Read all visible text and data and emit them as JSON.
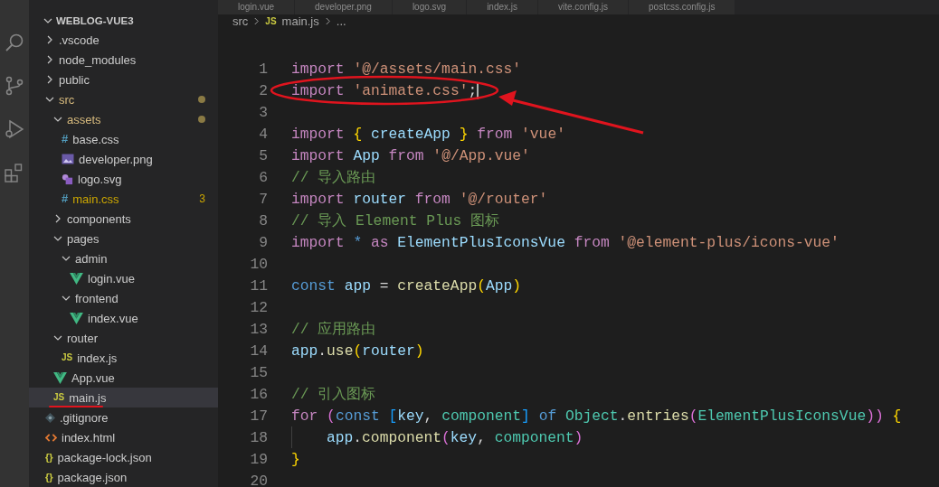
{
  "tabs": [
    {
      "label": "login.vue",
      "selected": false
    },
    {
      "label": "developer.png",
      "selected": false
    },
    {
      "label": "logo.svg",
      "selected": false
    },
    {
      "label": "index.js",
      "selected": false
    },
    {
      "label": "vite.config.js",
      "selected": false
    },
    {
      "label": "postcss.config.js",
      "selected": false
    }
  ],
  "explorer": {
    "title": "WEBLOG-VUE3",
    "expanded": true,
    "items": [
      {
        "name": ".vscode",
        "kind": "folder",
        "expanded": false,
        "selected": false,
        "modified": false
      },
      {
        "name": "node_modules",
        "kind": "folder",
        "expanded": false,
        "selected": false,
        "modified": false
      },
      {
        "name": "public",
        "kind": "folder",
        "expanded": false,
        "selected": false,
        "modified": false
      },
      {
        "name": "src",
        "kind": "folder",
        "expanded": true,
        "selected": false,
        "modified": true,
        "children": [
          {
            "name": "assets",
            "kind": "folder",
            "expanded": true,
            "selected": false,
            "modified": true,
            "children": [
              {
                "name": "base.css",
                "kind": "css",
                "icon": "#",
                "selected": false,
                "modified": false
              },
              {
                "name": "developer.png",
                "kind": "image",
                "selected": false,
                "modified": false
              },
              {
                "name": "logo.svg",
                "kind": "svg",
                "selected": false,
                "modified": false
              },
              {
                "name": "main.css",
                "kind": "css",
                "icon": "#",
                "selected": false,
                "modified": false,
                "badge": "3"
              }
            ]
          },
          {
            "name": "components",
            "kind": "folder",
            "expanded": false,
            "selected": false,
            "modified": false
          },
          {
            "name": "pages",
            "kind": "folder",
            "expanded": true,
            "selected": false,
            "modified": false,
            "children": [
              {
                "name": "admin",
                "kind": "folder",
                "expanded": true,
                "selected": false,
                "modified": false,
                "children": [
                  {
                    "name": "login.vue",
                    "kind": "vue",
                    "selected": false,
                    "modified": false
                  }
                ]
              },
              {
                "name": "frontend",
                "kind": "folder",
                "expanded": true,
                "selected": false,
                "modified": false,
                "children": [
                  {
                    "name": "index.vue",
                    "kind": "vue",
                    "selected": false,
                    "modified": false
                  }
                ]
              }
            ]
          },
          {
            "name": "router",
            "kind": "folder",
            "expanded": true,
            "selected": false,
            "modified": false,
            "children": [
              {
                "name": "index.js",
                "kind": "js",
                "icon": "JS",
                "selected": false,
                "modified": false
              }
            ]
          },
          {
            "name": "App.vue",
            "kind": "vue",
            "selected": false,
            "modified": false
          },
          {
            "name": "main.js",
            "kind": "js",
            "icon": "JS",
            "selected": true,
            "modified": false
          }
        ]
      },
      {
        "name": ".gitignore",
        "kind": "git",
        "selected": false,
        "modified": false
      },
      {
        "name": "index.html",
        "kind": "html",
        "selected": false,
        "modified": false
      },
      {
        "name": "package-lock.json",
        "kind": "json",
        "icon": "{}",
        "selected": false,
        "modified": false
      },
      {
        "name": "package.json",
        "kind": "json",
        "icon": "{}",
        "selected": false,
        "modified": false
      }
    ]
  },
  "breadcrumb": {
    "parts": [
      {
        "text": "src",
        "kind": "folder"
      },
      {
        "text": "main.js",
        "kind": "js",
        "icon": "JS"
      },
      {
        "text": "...",
        "kind": "more"
      }
    ]
  },
  "editor": {
    "lines": [
      {
        "number": "1",
        "cursor": false,
        "tokens": [
          {
            "text": "import ",
            "kind": "keyword"
          },
          {
            "text": "'@/assets/main.css'",
            "kind": "string"
          }
        ]
      },
      {
        "number": "2",
        "cursor": true,
        "tokens": [
          {
            "text": "import ",
            "kind": "keyword"
          },
          {
            "text": "'animate.css'",
            "kind": "string"
          },
          {
            "text": ";",
            "kind": "plain"
          }
        ]
      },
      {
        "number": "3",
        "cursor": false
      },
      {
        "number": "4",
        "cursor": false,
        "tokens": [
          {
            "text": "import ",
            "kind": "keyword"
          },
          {
            "text": "{",
            "kind": "brace"
          },
          {
            "text": " createApp ",
            "kind": "variable"
          },
          {
            "text": "}",
            "kind": "brace"
          },
          {
            "text": " from ",
            "kind": "keyword"
          },
          {
            "text": "'vue'",
            "kind": "string"
          }
        ]
      },
      {
        "number": "5",
        "cursor": false,
        "tokens": [
          {
            "text": "import ",
            "kind": "keyword"
          },
          {
            "text": "App ",
            "kind": "variable"
          },
          {
            "text": "from ",
            "kind": "keyword"
          },
          {
            "text": "'@/App.vue'",
            "kind": "string"
          }
        ]
      },
      {
        "number": "6",
        "cursor": false,
        "tokens": [
          {
            "text": "// 导入路由",
            "kind": "comment"
          }
        ]
      },
      {
        "number": "7",
        "cursor": false,
        "tokens": [
          {
            "text": "import ",
            "kind": "keyword"
          },
          {
            "text": "router ",
            "kind": "variable"
          },
          {
            "text": "from ",
            "kind": "keyword"
          },
          {
            "text": "'@/router'",
            "kind": "string"
          }
        ]
      },
      {
        "number": "8",
        "cursor": false,
        "tokens": [
          {
            "text": "// 导入 Element Plus 图标",
            "kind": "comment"
          }
        ]
      },
      {
        "number": "9",
        "cursor": false,
        "tokens": [
          {
            "text": "import ",
            "kind": "keyword"
          },
          {
            "text": "* ",
            "kind": "storage"
          },
          {
            "text": "as ",
            "kind": "keyword"
          },
          {
            "text": "ElementPlusIconsVue ",
            "kind": "variable"
          },
          {
            "text": "from ",
            "kind": "keyword"
          },
          {
            "text": "'@element-plus/icons-vue'",
            "kind": "string"
          }
        ]
      },
      {
        "number": "10",
        "cursor": false
      },
      {
        "number": "11",
        "cursor": false,
        "tokens": [
          {
            "text": "const ",
            "kind": "storage"
          },
          {
            "text": "app",
            "kind": "variable"
          },
          {
            "text": " = ",
            "kind": "plain"
          },
          {
            "text": "createApp",
            "kind": "function"
          },
          {
            "text": "(",
            "kind": "brace"
          },
          {
            "text": "App",
            "kind": "variable"
          },
          {
            "text": ")",
            "kind": "brace"
          }
        ]
      },
      {
        "number": "12",
        "cursor": false
      },
      {
        "number": "13",
        "cursor": false,
        "tokens": [
          {
            "text": "// 应用路由",
            "kind": "comment"
          }
        ]
      },
      {
        "number": "14",
        "cursor": false,
        "tokens": [
          {
            "text": "app",
            "kind": "variable"
          },
          {
            "text": ".",
            "kind": "plain"
          },
          {
            "text": "use",
            "kind": "function"
          },
          {
            "text": "(",
            "kind": "brace"
          },
          {
            "text": "router",
            "kind": "variable"
          },
          {
            "text": ")",
            "kind": "brace"
          }
        ]
      },
      {
        "number": "15",
        "cursor": false
      },
      {
        "number": "16",
        "cursor": false,
        "tokens": [
          {
            "text": "// 引入图标",
            "kind": "comment"
          }
        ]
      },
      {
        "number": "17",
        "cursor": false,
        "tokens": [
          {
            "text": "for ",
            "kind": "keyword"
          },
          {
            "text": "(",
            "kind": "paren"
          },
          {
            "text": "const ",
            "kind": "storage"
          },
          {
            "text": "[",
            "kind": "bracket"
          },
          {
            "text": "key",
            "kind": "variable"
          },
          {
            "text": ", ",
            "kind": "plain"
          },
          {
            "text": "component",
            "kind": "type"
          },
          {
            "text": "]",
            "kind": "bracket"
          },
          {
            "text": " of ",
            "kind": "storage"
          },
          {
            "text": "Object",
            "kind": "type"
          },
          {
            "text": ".",
            "kind": "plain"
          },
          {
            "text": "entries",
            "kind": "function"
          },
          {
            "text": "(",
            "kind": "paren"
          },
          {
            "text": "ElementPlusIconsVue",
            "kind": "type"
          },
          {
            "text": "))",
            "kind": "paren"
          },
          {
            "text": " {",
            "kind": "brace"
          }
        ]
      },
      {
        "number": "18",
        "cursor": false,
        "indent": true,
        "tokens": [
          {
            "text": "app",
            "kind": "variable"
          },
          {
            "text": ".",
            "kind": "plain"
          },
          {
            "text": "component",
            "kind": "function"
          },
          {
            "text": "(",
            "kind": "paren"
          },
          {
            "text": "key",
            "kind": "variable"
          },
          {
            "text": ", ",
            "kind": "plain"
          },
          {
            "text": "component",
            "kind": "type"
          },
          {
            "text": ")",
            "kind": "paren"
          }
        ]
      },
      {
        "number": "19",
        "cursor": false,
        "tokens": [
          {
            "text": "}",
            "kind": "brace"
          }
        ]
      },
      {
        "number": "20",
        "cursor": false
      }
    ]
  }
}
